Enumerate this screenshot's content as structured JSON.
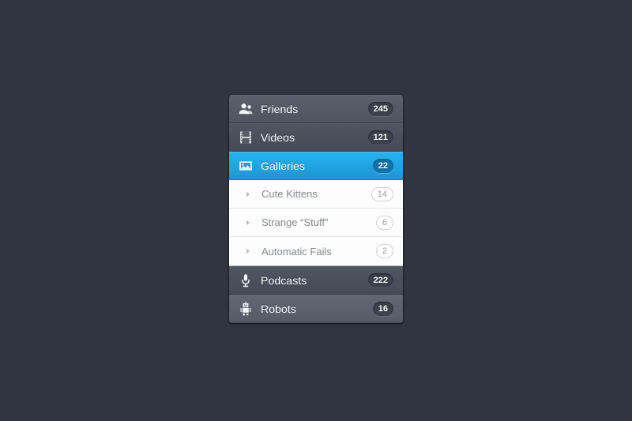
{
  "background_color": "#31353f",
  "panel": {
    "accent_color": "#1ba9e8",
    "items": [
      {
        "id": "friends",
        "label": "Friends",
        "badge": "245",
        "icon": "friends-icon",
        "state": "normal",
        "style": "variant-a"
      },
      {
        "id": "videos",
        "label": "Videos",
        "badge": "121",
        "icon": "film-strip-icon",
        "state": "normal",
        "style": "variant-b"
      },
      {
        "id": "galleries",
        "label": "Galleries",
        "badge": "22",
        "icon": "image-icon",
        "state": "active",
        "style": "active",
        "children": [
          {
            "id": "cute-kittens",
            "label": "Cute Kittens",
            "badge": "14",
            "arrow": "chevron-right-icon"
          },
          {
            "id": "strange-stuff",
            "label": "Strange “Stuff”",
            "badge": "6",
            "arrow": "chevron-right-icon"
          },
          {
            "id": "automatic-fails",
            "label": "Automatic Fails",
            "badge": "2",
            "arrow": "chevron-right-icon"
          }
        ]
      },
      {
        "id": "podcasts",
        "label": "Podcasts",
        "badge": "222",
        "icon": "microphone-icon",
        "state": "normal",
        "style": "variant-b"
      },
      {
        "id": "robots",
        "label": "Robots",
        "badge": "16",
        "icon": "robot-icon",
        "state": "hover",
        "style": "variant-hover"
      }
    ]
  }
}
